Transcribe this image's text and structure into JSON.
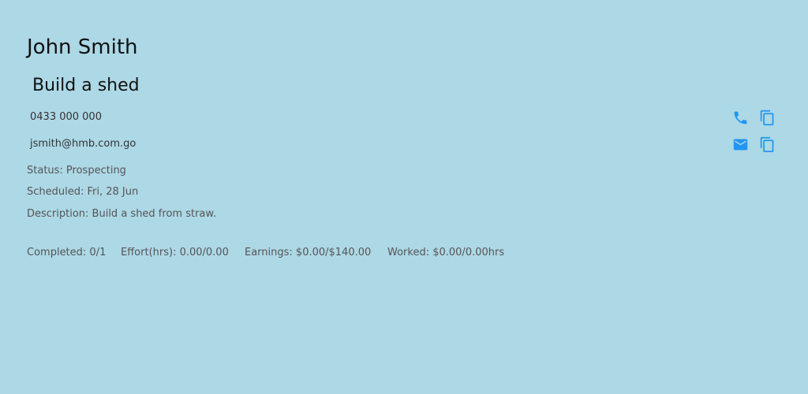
{
  "customer": {
    "name": "John Smith"
  },
  "job": {
    "title": "Build a shed",
    "phone": "0433 000 000",
    "email": "jsmith@hmb.com.go",
    "status_text": "Status: Prospecting",
    "scheduled_text": "Scheduled: Fri, 28 Jun",
    "description_text": "Description: Build a shed from straw."
  },
  "stats": {
    "completed": "Completed: 0/1",
    "effort": "Effort(hrs): 0.00/0.00",
    "earnings": "Earnings: $0.00/$140.00",
    "worked": "Worked: $0.00/0.00hrs"
  },
  "icons": {
    "phone_action": "phone-icon",
    "email_action": "email-icon",
    "copy": "copy-icon"
  },
  "colors": {
    "background": "#add8e6",
    "accent": "#2196f3"
  }
}
